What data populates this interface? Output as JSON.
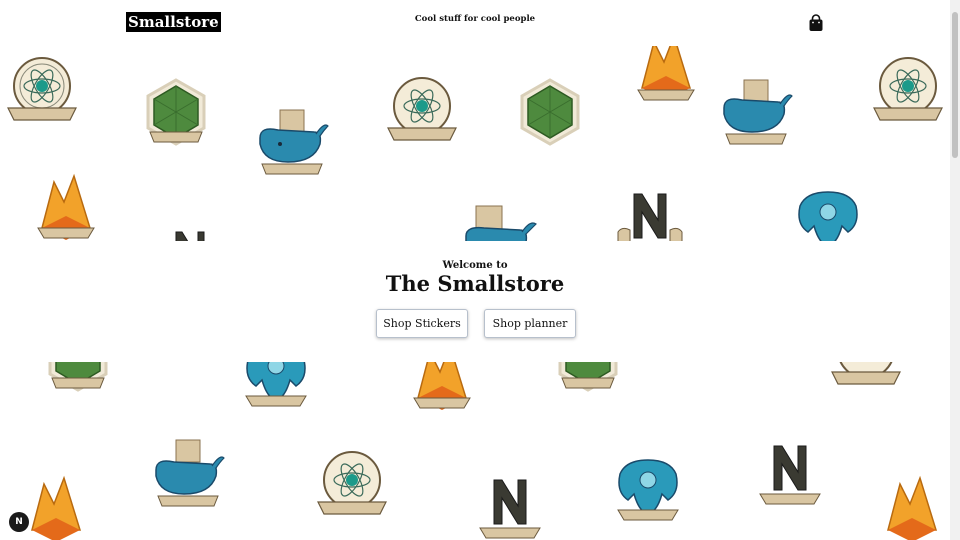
{
  "header": {
    "logo": "Smallstore",
    "tagline": "Cool stuff for cool people",
    "cart_icon": "shopping-bag-icon"
  },
  "hero": {
    "welcome": "Welcome to",
    "title": "The Smallstore",
    "buttons": [
      "Shop Stickers",
      "Shop planner"
    ]
  },
  "stickers": {
    "labels": [
      "REACT",
      "NODE",
      "DOCKER",
      "FIREBASE",
      "NEXT",
      "POSTGRESQL"
    ]
  },
  "dev_badge": "N"
}
